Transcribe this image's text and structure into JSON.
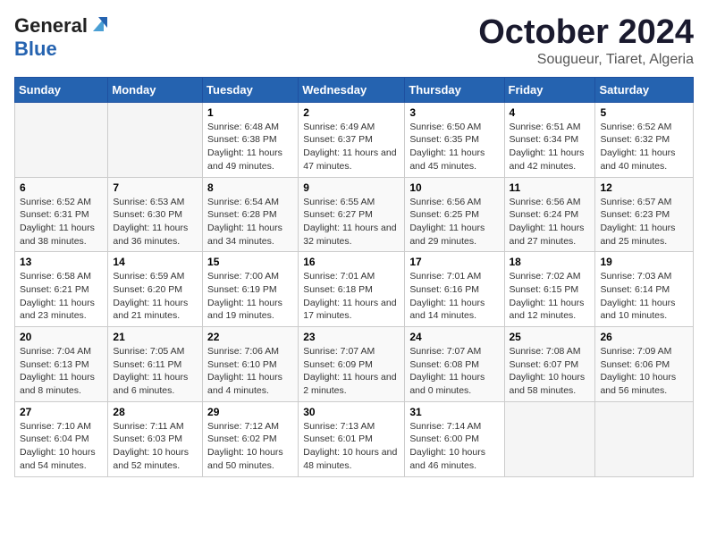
{
  "header": {
    "logo_general": "General",
    "logo_blue": "Blue",
    "month": "October 2024",
    "location": "Sougueur, Tiaret, Algeria"
  },
  "days_of_week": [
    "Sunday",
    "Monday",
    "Tuesday",
    "Wednesday",
    "Thursday",
    "Friday",
    "Saturday"
  ],
  "weeks": [
    [
      {
        "day": "",
        "info": ""
      },
      {
        "day": "",
        "info": ""
      },
      {
        "day": "1",
        "sunrise": "6:48 AM",
        "sunset": "6:38 PM",
        "daylight": "11 hours and 49 minutes."
      },
      {
        "day": "2",
        "sunrise": "6:49 AM",
        "sunset": "6:37 PM",
        "daylight": "11 hours and 47 minutes."
      },
      {
        "day": "3",
        "sunrise": "6:50 AM",
        "sunset": "6:35 PM",
        "daylight": "11 hours and 45 minutes."
      },
      {
        "day": "4",
        "sunrise": "6:51 AM",
        "sunset": "6:34 PM",
        "daylight": "11 hours and 42 minutes."
      },
      {
        "day": "5",
        "sunrise": "6:52 AM",
        "sunset": "6:32 PM",
        "daylight": "11 hours and 40 minutes."
      }
    ],
    [
      {
        "day": "6",
        "sunrise": "6:52 AM",
        "sunset": "6:31 PM",
        "daylight": "11 hours and 38 minutes."
      },
      {
        "day": "7",
        "sunrise": "6:53 AM",
        "sunset": "6:30 PM",
        "daylight": "11 hours and 36 minutes."
      },
      {
        "day": "8",
        "sunrise": "6:54 AM",
        "sunset": "6:28 PM",
        "daylight": "11 hours and 34 minutes."
      },
      {
        "day": "9",
        "sunrise": "6:55 AM",
        "sunset": "6:27 PM",
        "daylight": "11 hours and 32 minutes."
      },
      {
        "day": "10",
        "sunrise": "6:56 AM",
        "sunset": "6:25 PM",
        "daylight": "11 hours and 29 minutes."
      },
      {
        "day": "11",
        "sunrise": "6:56 AM",
        "sunset": "6:24 PM",
        "daylight": "11 hours and 27 minutes."
      },
      {
        "day": "12",
        "sunrise": "6:57 AM",
        "sunset": "6:23 PM",
        "daylight": "11 hours and 25 minutes."
      }
    ],
    [
      {
        "day": "13",
        "sunrise": "6:58 AM",
        "sunset": "6:21 PM",
        "daylight": "11 hours and 23 minutes."
      },
      {
        "day": "14",
        "sunrise": "6:59 AM",
        "sunset": "6:20 PM",
        "daylight": "11 hours and 21 minutes."
      },
      {
        "day": "15",
        "sunrise": "7:00 AM",
        "sunset": "6:19 PM",
        "daylight": "11 hours and 19 minutes."
      },
      {
        "day": "16",
        "sunrise": "7:01 AM",
        "sunset": "6:18 PM",
        "daylight": "11 hours and 17 minutes."
      },
      {
        "day": "17",
        "sunrise": "7:01 AM",
        "sunset": "6:16 PM",
        "daylight": "11 hours and 14 minutes."
      },
      {
        "day": "18",
        "sunrise": "7:02 AM",
        "sunset": "6:15 PM",
        "daylight": "11 hours and 12 minutes."
      },
      {
        "day": "19",
        "sunrise": "7:03 AM",
        "sunset": "6:14 PM",
        "daylight": "11 hours and 10 minutes."
      }
    ],
    [
      {
        "day": "20",
        "sunrise": "7:04 AM",
        "sunset": "6:13 PM",
        "daylight": "11 hours and 8 minutes."
      },
      {
        "day": "21",
        "sunrise": "7:05 AM",
        "sunset": "6:11 PM",
        "daylight": "11 hours and 6 minutes."
      },
      {
        "day": "22",
        "sunrise": "7:06 AM",
        "sunset": "6:10 PM",
        "daylight": "11 hours and 4 minutes."
      },
      {
        "day": "23",
        "sunrise": "7:07 AM",
        "sunset": "6:09 PM",
        "daylight": "11 hours and 2 minutes."
      },
      {
        "day": "24",
        "sunrise": "7:07 AM",
        "sunset": "6:08 PM",
        "daylight": "11 hours and 0 minutes."
      },
      {
        "day": "25",
        "sunrise": "7:08 AM",
        "sunset": "6:07 PM",
        "daylight": "10 hours and 58 minutes."
      },
      {
        "day": "26",
        "sunrise": "7:09 AM",
        "sunset": "6:06 PM",
        "daylight": "10 hours and 56 minutes."
      }
    ],
    [
      {
        "day": "27",
        "sunrise": "7:10 AM",
        "sunset": "6:04 PM",
        "daylight": "10 hours and 54 minutes."
      },
      {
        "day": "28",
        "sunrise": "7:11 AM",
        "sunset": "6:03 PM",
        "daylight": "10 hours and 52 minutes."
      },
      {
        "day": "29",
        "sunrise": "7:12 AM",
        "sunset": "6:02 PM",
        "daylight": "10 hours and 50 minutes."
      },
      {
        "day": "30",
        "sunrise": "7:13 AM",
        "sunset": "6:01 PM",
        "daylight": "10 hours and 48 minutes."
      },
      {
        "day": "31",
        "sunrise": "7:14 AM",
        "sunset": "6:00 PM",
        "daylight": "10 hours and 46 minutes."
      },
      {
        "day": "",
        "info": ""
      },
      {
        "day": "",
        "info": ""
      }
    ]
  ],
  "labels": {
    "sunrise": "Sunrise:",
    "sunset": "Sunset:",
    "daylight": "Daylight:"
  }
}
